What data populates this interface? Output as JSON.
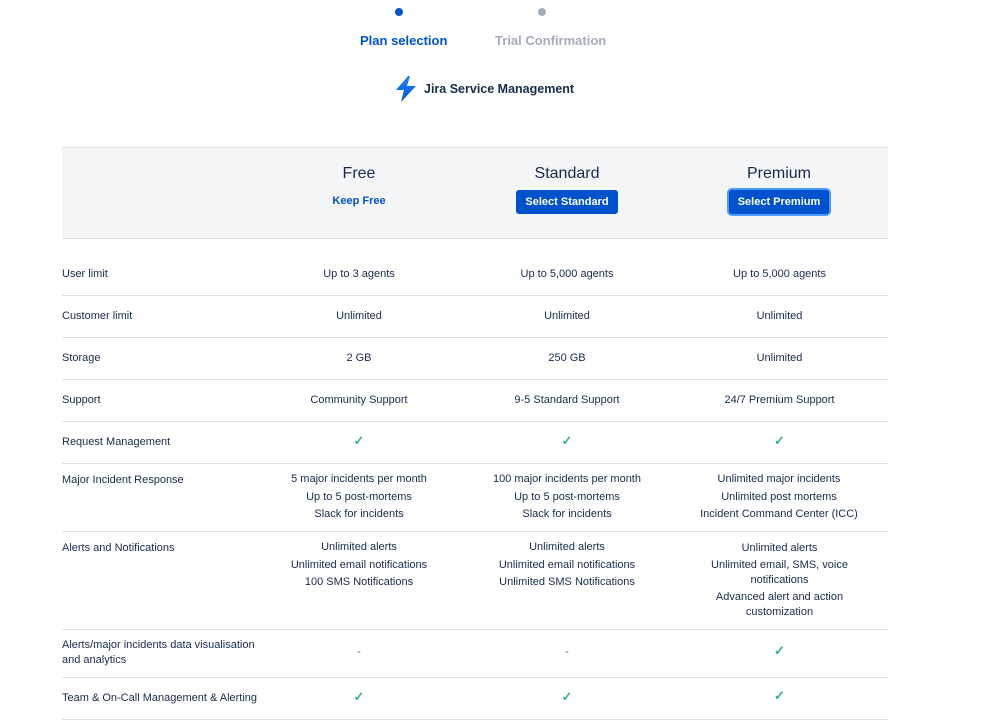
{
  "stepper": {
    "steps": [
      {
        "label": "Plan selection",
        "state": "active"
      },
      {
        "label": "Trial Confirmation",
        "state": "inactive"
      }
    ]
  },
  "product": {
    "name": "Jira Service Management",
    "icon": "jira-service-management-logo"
  },
  "plans": [
    {
      "name": "Free",
      "action": "Keep Free",
      "action_style": "link"
    },
    {
      "name": "Standard",
      "action": "Select Standard",
      "action_style": "primary"
    },
    {
      "name": "Premium",
      "action": "Select Premium",
      "action_style": "primary-focused"
    }
  ],
  "features": [
    {
      "label": "User limit",
      "free": "Up to 3 agents",
      "standard": "Up to 5,000 agents",
      "premium": "Up to 5,000 agents"
    },
    {
      "label": "Customer limit",
      "free": "Unlimited",
      "standard": "Unlimited",
      "premium": "Unlimited"
    },
    {
      "label": "Storage",
      "free": "2 GB",
      "standard": "250 GB",
      "premium": "Unlimited"
    },
    {
      "label": "Support",
      "free": "Community Support",
      "standard": "9-5 Standard Support",
      "premium": "24/7 Premium Support"
    },
    {
      "label": "Request Management",
      "free": "check",
      "standard": "check",
      "premium": "check"
    },
    {
      "label": "Major Incident Response",
      "free": [
        "5 major incidents per month",
        "Up to 5 post-mortems",
        "Slack for incidents"
      ],
      "standard": [
        "100 major incidents per month",
        "Up to 5 post-mortems",
        "Slack for incidents"
      ],
      "premium": [
        "Unlimited major incidents",
        "Unlimited post mortems",
        "Incident Command Center (ICC)"
      ]
    },
    {
      "label": "Alerts and Notifications",
      "free": [
        "Unlimited alerts",
        "Unlimited email notifications",
        "100 SMS Notifications"
      ],
      "standard": [
        "Unlimited alerts",
        "Unlimited email notifications",
        "Unlimited SMS Notifications"
      ],
      "premium": [
        "Unlimited alerts",
        "Unlimited email, SMS, voice notifications",
        "Advanced alert and action customization"
      ]
    },
    {
      "label": "Alerts/major incidents data visualisation and analytics",
      "free": "-",
      "standard": "-",
      "premium": "check"
    },
    {
      "label": "Team & On-Call Management & Alerting",
      "free": "check",
      "standard": "check",
      "premium": "check"
    }
  ],
  "colors": {
    "accent": "#0052cc",
    "check": "#36b37e",
    "header_bg": "#f4f5f7",
    "muted": "#a5adba"
  }
}
